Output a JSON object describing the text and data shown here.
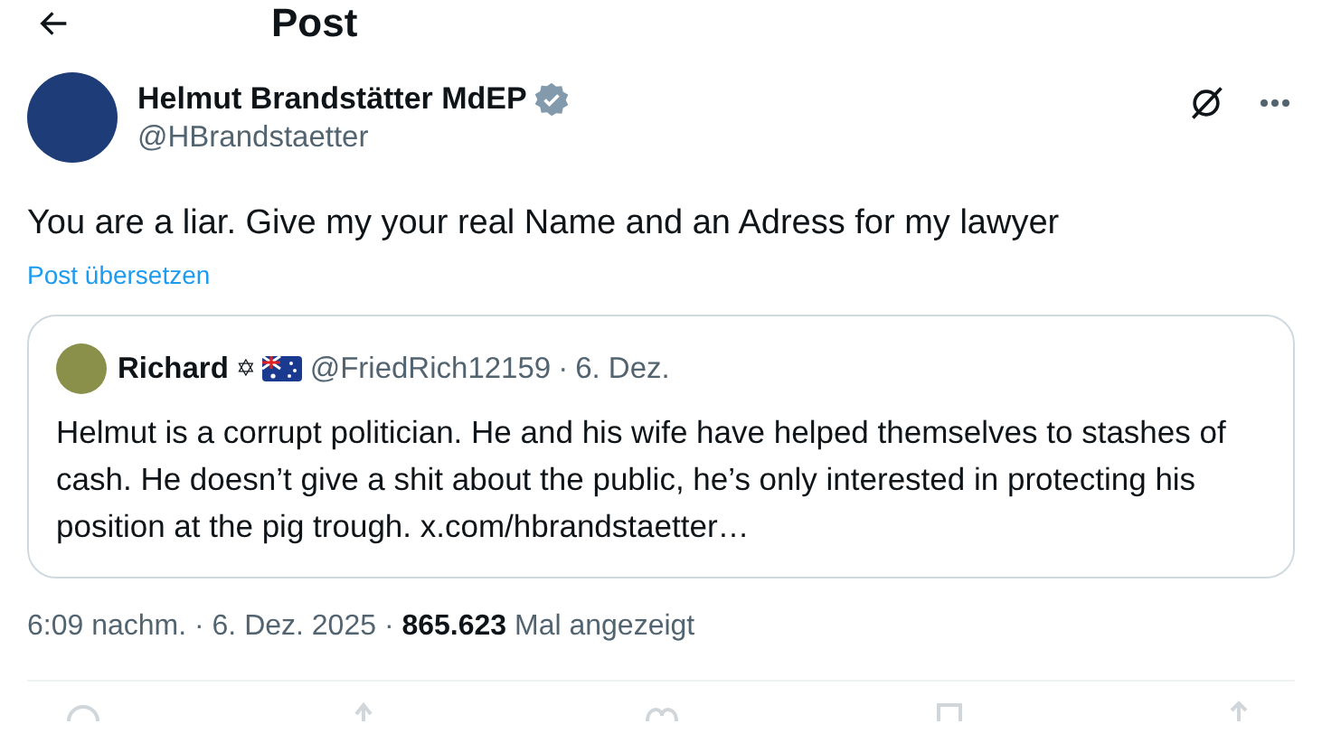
{
  "header": {
    "title": "Post"
  },
  "post": {
    "author": {
      "name": "Helmut Brandstätter MdEP",
      "verified": true,
      "handle": "@HBrandstaetter"
    },
    "text": "You are a liar. Give my your real Name and an Adress for my lawyer",
    "translate_link": "Post übersetzen",
    "quote": {
      "name": "Richard",
      "name_symbol": "✡",
      "handle": "@FriedRich12159",
      "separator": "·",
      "date": "6. Dez.",
      "text": "Helmut is a corrupt politician. He and his wife have helped themselves to stashes of cash. He doesn’t give a shit about the public, he’s only interested in protecting his position at the pig trough. x.com/hbrandstaetter…"
    },
    "meta": "6:09 nachm. · 6. Dez. 2025 · **865.623** Mal angezeigt"
  }
}
